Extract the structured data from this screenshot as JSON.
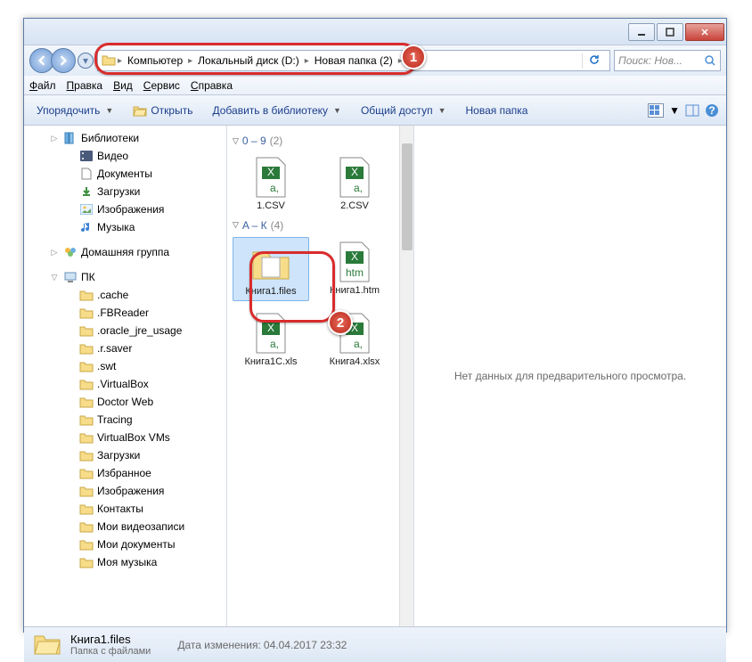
{
  "titlebar": {
    "min": "_",
    "max": "▢",
    "close": "✕"
  },
  "breadcrumb": [
    "Компьютер",
    "Локальный диск (D:)",
    "Новая папка (2)"
  ],
  "search": {
    "placeholder": "Поиск: Нов..."
  },
  "menu": [
    "Файл",
    "Правка",
    "Вид",
    "Сервис",
    "Справка"
  ],
  "toolbar": {
    "organize": "Упорядочить",
    "open": "Открыть",
    "include": "Добавить в библиотеку",
    "share": "Общий доступ",
    "new_folder": "Новая папка"
  },
  "tree": {
    "libraries": "Библиотеки",
    "videos": "Видео",
    "documents": "Документы",
    "downloads_lib": "Загрузки",
    "pictures": "Изображения",
    "music": "Музыка",
    "homegroup": "Домашняя группа",
    "computer": "ПК",
    "folders": [
      ".cache",
      ".FBReader",
      ".oracle_jre_usage",
      ".r.saver",
      ".swt",
      ".VirtualBox",
      "Doctor Web",
      "Tracing",
      "VirtualBox VMs",
      "Загрузки",
      "Избранное",
      "Изображения",
      "Контакты",
      "Мои видеозаписи",
      "Мои документы",
      "Моя музыка"
    ]
  },
  "groups": [
    {
      "title": "0 – 9",
      "count": "(2)",
      "items": [
        {
          "name": "1.CSV",
          "type": "csv"
        },
        {
          "name": "2.CSV",
          "type": "csv"
        }
      ]
    },
    {
      "title": "A – К",
      "count": "(4)",
      "items": [
        {
          "name": "Книга1.files",
          "type": "folder",
          "selected": true
        },
        {
          "name": "Книга1.htm",
          "type": "htm"
        },
        {
          "name": "Книга1C.xls",
          "type": "xls"
        },
        {
          "name": "Книга4.xlsx",
          "type": "xlsx"
        }
      ]
    }
  ],
  "preview": {
    "empty": "Нет данных для предварительного просмотра."
  },
  "status": {
    "name": "Книга1.files",
    "type": "Папка с файлами",
    "date_label": "Дата изменения:",
    "date": "04.04.2017 23:32"
  },
  "annotations": {
    "a1": "1",
    "a2": "2"
  }
}
